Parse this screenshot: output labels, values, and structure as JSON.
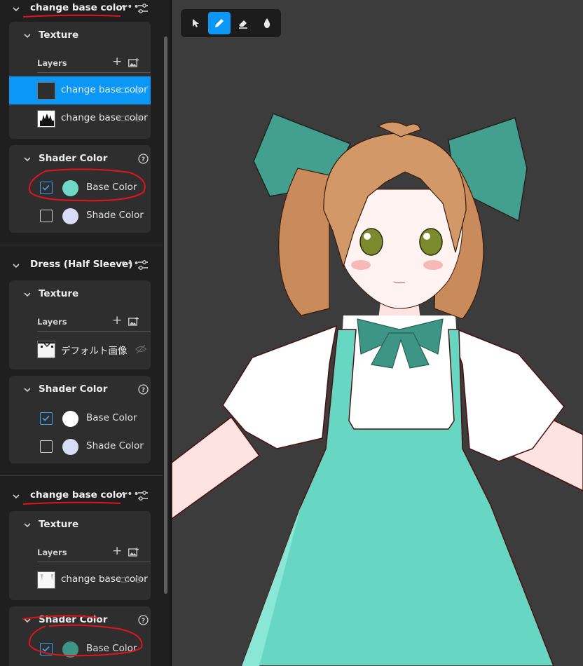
{
  "sidebar": {
    "sections": [
      {
        "title": "change base color",
        "texture": {
          "title": "Texture",
          "layers_label": "Layers",
          "layers": [
            {
              "name": "change base color",
              "selected": true
            },
            {
              "name": "change base color",
              "selected": false
            }
          ]
        },
        "shader": {
          "title": "Shader Color",
          "colors": [
            {
              "label": "Base Color",
              "checked": true,
              "swatch": "#6fd9c5"
            },
            {
              "label": "Shade Color",
              "checked": false,
              "swatch": "#d9dcf7"
            }
          ]
        }
      },
      {
        "title": "Dress (Half Sleeve)",
        "texture": {
          "title": "Texture",
          "layers_label": "Layers",
          "layers": [
            {
              "name": "デフォルト画像",
              "selected": false
            }
          ]
        },
        "shader": {
          "title": "Shader Color",
          "colors": [
            {
              "label": "Base Color",
              "checked": true,
              "swatch": "#ffffff"
            },
            {
              "label": "Shade Color",
              "checked": false,
              "swatch": "#d9dcf7"
            }
          ]
        }
      },
      {
        "title": "change base color",
        "texture": {
          "title": "Texture",
          "layers_label": "Layers",
          "layers": [
            {
              "name": "change base color",
              "selected": false
            }
          ]
        },
        "shader": {
          "title": "Shader Color",
          "colors": [
            {
              "label": "Base Color",
              "checked": true,
              "swatch": "#3d9585"
            }
          ]
        }
      }
    ]
  },
  "toolbar": {
    "tools": [
      {
        "icon": "select-arrow-icon",
        "active": false
      },
      {
        "icon": "pen-icon",
        "active": true
      },
      {
        "icon": "eraser-icon",
        "active": false
      },
      {
        "icon": "fill-drop-icon",
        "active": false
      }
    ]
  },
  "colors": {
    "accent": "#0a97f5",
    "panel_bg": "#1f1f1f",
    "card_bg": "#2e2e2e",
    "viewport_bg": "#3c3c3c",
    "annotation_red": "#e0141e"
  }
}
